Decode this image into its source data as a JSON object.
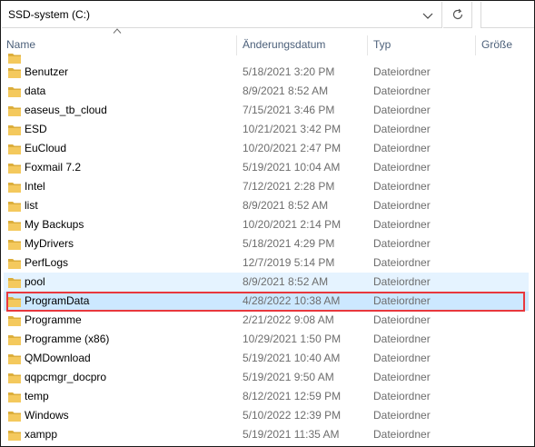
{
  "address": {
    "path": "SSD-system (C:)"
  },
  "columns": {
    "name": "Name",
    "date": "Änderungsdatum",
    "type": "Typ",
    "size": "Größe"
  },
  "colors": {
    "folder": "#f4c95d",
    "folder_dark": "#dcae3b",
    "hover_bg": "#e5f3ff",
    "selected_bg": "#cce8ff",
    "highlight_outline": "#e8383d"
  },
  "rows": [
    {
      "name": "Benutzer",
      "date": "5/18/2021 3:20 PM",
      "type": "Dateiordner",
      "icon": "folder-icon"
    },
    {
      "name": "data",
      "date": "8/9/2021 8:52 AM",
      "type": "Dateiordner",
      "icon": "folder-icon"
    },
    {
      "name": "easeus_tb_cloud",
      "date": "7/15/2021 3:46 PM",
      "type": "Dateiordner",
      "icon": "folder-icon"
    },
    {
      "name": "ESD",
      "date": "10/21/2021 3:42 PM",
      "type": "Dateiordner",
      "icon": "folder-icon"
    },
    {
      "name": "EuCloud",
      "date": "10/20/2021 2:47 PM",
      "type": "Dateiordner",
      "icon": "folder-icon"
    },
    {
      "name": "Foxmail 7.2",
      "date": "5/19/2021 10:04 AM",
      "type": "Dateiordner",
      "icon": "folder-icon"
    },
    {
      "name": "Intel",
      "date": "7/12/2021 2:28 PM",
      "type": "Dateiordner",
      "icon": "folder-icon"
    },
    {
      "name": "list",
      "date": "8/9/2021 8:52 AM",
      "type": "Dateiordner",
      "icon": "folder-icon"
    },
    {
      "name": "My Backups",
      "date": "10/20/2021 2:14 PM",
      "type": "Dateiordner",
      "icon": "folder-icon"
    },
    {
      "name": "MyDrivers",
      "date": "5/18/2021 4:29 PM",
      "type": "Dateiordner",
      "icon": "folder-icon"
    },
    {
      "name": "PerfLogs",
      "date": "12/7/2019 5:14 PM",
      "type": "Dateiordner",
      "icon": "folder-icon"
    },
    {
      "name": "pool",
      "date": "8/9/2021 8:52 AM",
      "type": "Dateiordner",
      "icon": "folder-icon"
    },
    {
      "name": "ProgramData",
      "date": "4/28/2022 10:38 AM",
      "type": "Dateiordner",
      "icon": "folder-icon"
    },
    {
      "name": "Programme",
      "date": "2/21/2022 9:08 AM",
      "type": "Dateiordner",
      "icon": "folder-icon"
    },
    {
      "name": "Programme (x86)",
      "date": "10/29/2021 1:50 PM",
      "type": "Dateiordner",
      "icon": "folder-icon"
    },
    {
      "name": "QMDownload",
      "date": "5/19/2021 10:40 AM",
      "type": "Dateiordner",
      "icon": "folder-icon"
    },
    {
      "name": "qqpcmgr_docpro",
      "date": "5/19/2021 9:50 AM",
      "type": "Dateiordner",
      "icon": "folder-icon"
    },
    {
      "name": "temp",
      "date": "8/12/2021 12:59 PM",
      "type": "Dateiordner",
      "icon": "folder-icon"
    },
    {
      "name": "Windows",
      "date": "5/10/2022 12:39 PM",
      "type": "Dateiordner",
      "icon": "folder-icon"
    },
    {
      "name": "xampp",
      "date": "5/19/2021 11:35 AM",
      "type": "Dateiordner",
      "icon": "folder-icon"
    }
  ],
  "hover_row": "pool",
  "selected_row": "ProgramData"
}
